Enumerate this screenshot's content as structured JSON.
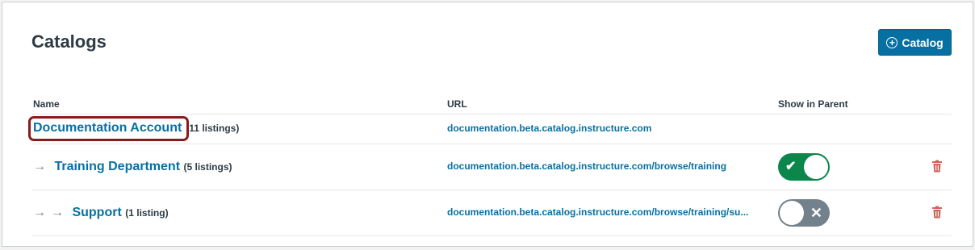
{
  "header": {
    "title": "Catalogs",
    "add_button_label": "Catalog",
    "add_button_icon": "plus-circle-icon"
  },
  "table": {
    "columns": [
      "Name",
      "URL",
      "Show in Parent"
    ],
    "rows": [
      {
        "name": "Documentation Account",
        "count": "11 listings)",
        "url": "documentation.beta.catalog.instructure.com",
        "indent": 0,
        "show_in_parent": null
      },
      {
        "name": "Training Department",
        "count": "(5 listings)",
        "url": "documentation.beta.catalog.instructure.com/browse/training",
        "indent": 1,
        "show_in_parent": true
      },
      {
        "name": "Support",
        "count": "(1 listing)",
        "url": "documentation.beta.catalog.instructure.com/browse/training/su...",
        "indent": 2,
        "show_in_parent": false
      }
    ]
  },
  "colors": {
    "accent": "#0770a3",
    "toggle_on": "#0b874b",
    "toggle_off": "#73818c",
    "highlight": "#8b1a1a",
    "trash": "#d0635b"
  },
  "icons": {
    "arrow": "arrow-right-icon",
    "trash": "trash-icon",
    "check": "check-icon",
    "x": "x-icon"
  }
}
